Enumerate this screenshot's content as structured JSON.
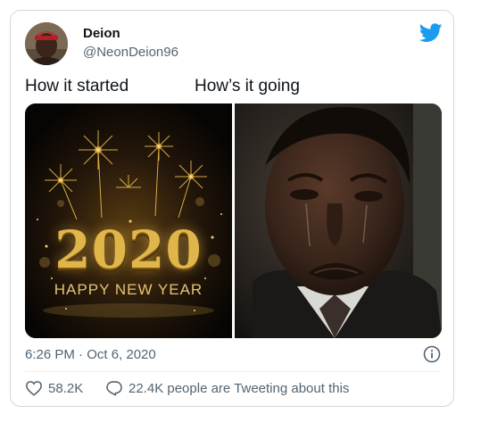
{
  "author": {
    "display_name": "Deion",
    "handle": "@NeonDeion96"
  },
  "captions": {
    "left": "How it started",
    "right": "How’s it going"
  },
  "media": {
    "left": {
      "year_text": "2020",
      "greeting_text": "HAPPY NEW YEAR"
    }
  },
  "meta": {
    "timestamp": "6:26 PM · Oct 6, 2020"
  },
  "actions": {
    "likes": "58.2K",
    "conversation": "22.4K people are Tweeting about this"
  },
  "colors": {
    "brand_blue": "#1d9bf0",
    "text_primary": "#0f1419",
    "text_secondary": "#536471",
    "border": "#cfd9de",
    "gold": "#e0b64a"
  },
  "icons": {
    "brand": "twitter-bird-icon",
    "info": "info-icon",
    "like": "heart-icon",
    "reply": "speech-bubble-icon"
  }
}
